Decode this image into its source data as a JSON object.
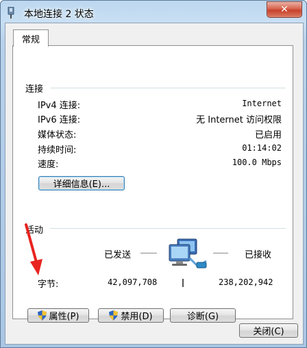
{
  "window": {
    "title": "本地连接 2 状态",
    "close_glyph": "✕"
  },
  "tabs": [
    {
      "label": "常规",
      "active": true
    }
  ],
  "connection": {
    "group_label": "连接",
    "rows": [
      {
        "label": "IPv4 连接:",
        "value": "Internet"
      },
      {
        "label": "IPv6 连接:",
        "value": "无 Internet 访问权限"
      },
      {
        "label": "媒体状态:",
        "value": "已启用"
      },
      {
        "label": "持续时间:",
        "value": "01:14:02"
      },
      {
        "label": "速度:",
        "value": "100.0 Mbps"
      }
    ],
    "details_button": "详细信息(E)..."
  },
  "activity": {
    "group_label": "活动",
    "sent_label": "已发送",
    "received_label": "已接收",
    "bytes_label": "字节:",
    "bytes_sent": "42,097,708",
    "bytes_received": "238,202,942"
  },
  "actions": {
    "properties": "属性(P)",
    "disable": "禁用(D)",
    "diagnose": "诊断(G)"
  },
  "footer": {
    "close": "关闭(C)"
  },
  "colors": {
    "annotation_arrow": "#e8231f",
    "title_gradient_top": "#bcd7ef",
    "close_red": "#c7412b"
  },
  "icons": [
    "network-adapter-icon",
    "close-icon",
    "uac-shield-icon",
    "network-computers-icon",
    "annotation-arrow"
  ]
}
